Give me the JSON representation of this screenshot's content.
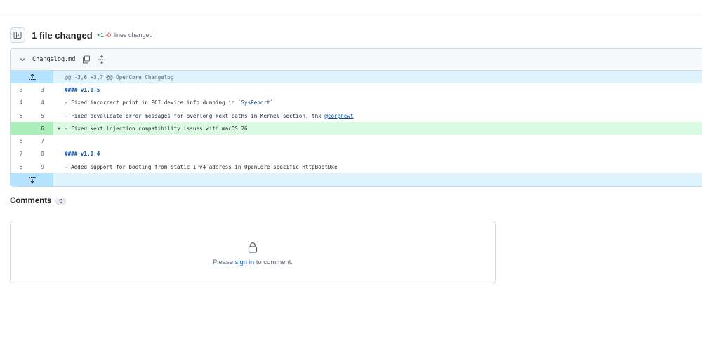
{
  "summary": {
    "title": "1 file changed",
    "additions": "+1",
    "deletions": "-0",
    "lines_label": "lines changed"
  },
  "file": {
    "name": "Changelog.md",
    "hunk_header": "@@ -3,6 +3,7 @@ OpenCore Changelog",
    "rows": [
      {
        "old": "3",
        "new": "3",
        "marker": "",
        "type": "context",
        "parts": [
          {
            "t": "#### v1.0.5",
            "k": "kw"
          }
        ]
      },
      {
        "old": "4",
        "new": "4",
        "marker": "",
        "type": "context",
        "parts": [
          {
            "t": "- Fixed incorrect print in PCI device info dumping in `",
            "k": ""
          },
          {
            "t": "SysReport",
            "k": "str"
          },
          {
            "t": "`",
            "k": ""
          }
        ]
      },
      {
        "old": "5",
        "new": "5",
        "marker": "",
        "type": "context",
        "parts": [
          {
            "t": "- Fixed ocvalidate error messages for overlong kext paths in Kernel section, thx ",
            "k": ""
          },
          {
            "t": "@corpnewt",
            "k": "link"
          }
        ]
      },
      {
        "old": "",
        "new": "6",
        "marker": "+",
        "type": "add",
        "parts": [
          {
            "t": "- Fixed kext injection compatibility issues with macOS 26",
            "k": ""
          }
        ]
      },
      {
        "old": "6",
        "new": "7",
        "marker": "",
        "type": "context",
        "parts": [
          {
            "t": "",
            "k": ""
          }
        ]
      },
      {
        "old": "7",
        "new": "8",
        "marker": "",
        "type": "context",
        "parts": [
          {
            "t": "#### v1.0.4",
            "k": "kw"
          }
        ]
      },
      {
        "old": "8",
        "new": "9",
        "marker": "",
        "type": "context",
        "parts": [
          {
            "t": "- Added support for booting from static IPv4 address in OpenCore-specific HttpBootDxe",
            "k": ""
          }
        ]
      }
    ]
  },
  "comments": {
    "title": "Comments",
    "count": "0",
    "prompt_before": "Please ",
    "prompt_link": "sign in",
    "prompt_after": " to comment."
  },
  "colors": {
    "addition": "#1a7f37",
    "deletion": "#d1242f",
    "hunk_bg": "#ddf4ff",
    "add_bg": "#dafbe1",
    "link": "#0969da"
  }
}
